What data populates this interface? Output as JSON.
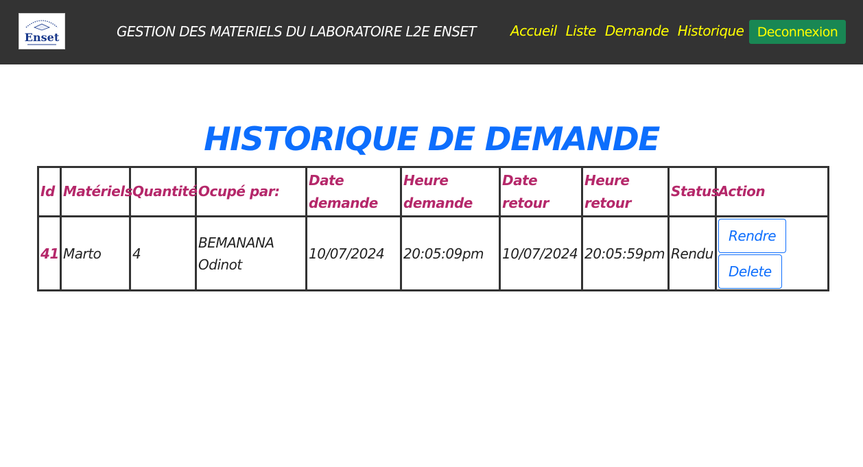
{
  "navbar": {
    "title": "GESTION DES MATERIELS DU LABORATOIRE L2E ENSET",
    "logo_icon": "enset-logo",
    "logo_text": "Enset",
    "links": [
      "Accueil",
      "Liste",
      "Demande",
      "Historique"
    ],
    "logout_label": "Deconnexion",
    "background": "#333333",
    "link_color": "#ffff00",
    "logout_color": "#198754"
  },
  "page": {
    "heading": "HISTORIQUE DE DEMANDE",
    "heading_color": "#0d6efd"
  },
  "table": {
    "header_color": "#b5286a",
    "columns": [
      "Id",
      "Matériels",
      "Quantité",
      "Ocupé par:",
      "Date demande",
      "Heure demande",
      "Date retour",
      "Heure retour",
      "Status",
      "Action"
    ],
    "rows": [
      {
        "id": "41",
        "materiel": "Marto",
        "quantite": "4",
        "occupe_par": "BEMANANA Odinot",
        "date_demande": "10/07/2024",
        "heure_demande": "20:05:09pm",
        "date_retour": "10/07/2024",
        "heure_retour": "20:05:59pm",
        "status": "Rendu",
        "actions": [
          "Rendre",
          "Delete"
        ]
      }
    ]
  }
}
